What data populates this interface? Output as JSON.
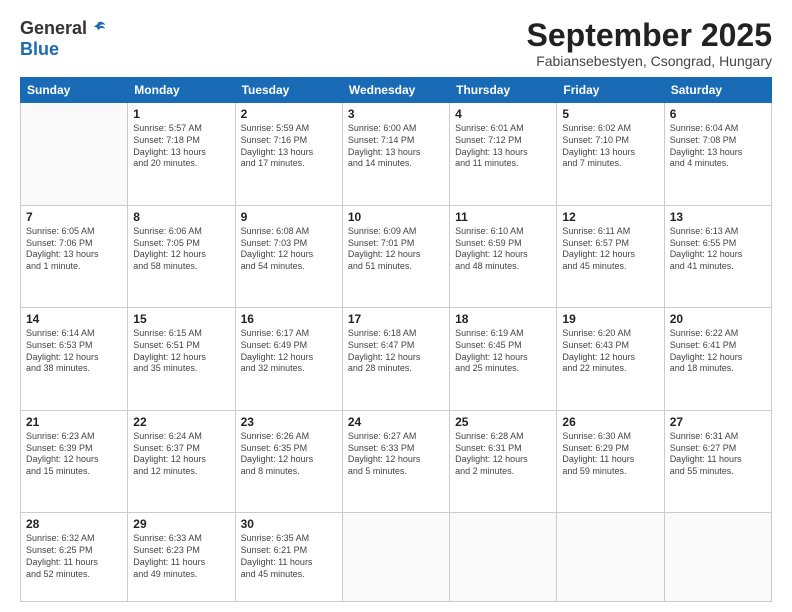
{
  "logo": {
    "general": "General",
    "blue": "Blue"
  },
  "header": {
    "month": "September 2025",
    "location": "Fabiansebestyen, Csongrad, Hungary"
  },
  "weekdays": [
    "Sunday",
    "Monday",
    "Tuesday",
    "Wednesday",
    "Thursday",
    "Friday",
    "Saturday"
  ],
  "weeks": [
    [
      {
        "day": "",
        "info": ""
      },
      {
        "day": "1",
        "info": "Sunrise: 5:57 AM\nSunset: 7:18 PM\nDaylight: 13 hours\nand 20 minutes."
      },
      {
        "day": "2",
        "info": "Sunrise: 5:59 AM\nSunset: 7:16 PM\nDaylight: 13 hours\nand 17 minutes."
      },
      {
        "day": "3",
        "info": "Sunrise: 6:00 AM\nSunset: 7:14 PM\nDaylight: 13 hours\nand 14 minutes."
      },
      {
        "day": "4",
        "info": "Sunrise: 6:01 AM\nSunset: 7:12 PM\nDaylight: 13 hours\nand 11 minutes."
      },
      {
        "day": "5",
        "info": "Sunrise: 6:02 AM\nSunset: 7:10 PM\nDaylight: 13 hours\nand 7 minutes."
      },
      {
        "day": "6",
        "info": "Sunrise: 6:04 AM\nSunset: 7:08 PM\nDaylight: 13 hours\nand 4 minutes."
      }
    ],
    [
      {
        "day": "7",
        "info": "Sunrise: 6:05 AM\nSunset: 7:06 PM\nDaylight: 13 hours\nand 1 minute."
      },
      {
        "day": "8",
        "info": "Sunrise: 6:06 AM\nSunset: 7:05 PM\nDaylight: 12 hours\nand 58 minutes."
      },
      {
        "day": "9",
        "info": "Sunrise: 6:08 AM\nSunset: 7:03 PM\nDaylight: 12 hours\nand 54 minutes."
      },
      {
        "day": "10",
        "info": "Sunrise: 6:09 AM\nSunset: 7:01 PM\nDaylight: 12 hours\nand 51 minutes."
      },
      {
        "day": "11",
        "info": "Sunrise: 6:10 AM\nSunset: 6:59 PM\nDaylight: 12 hours\nand 48 minutes."
      },
      {
        "day": "12",
        "info": "Sunrise: 6:11 AM\nSunset: 6:57 PM\nDaylight: 12 hours\nand 45 minutes."
      },
      {
        "day": "13",
        "info": "Sunrise: 6:13 AM\nSunset: 6:55 PM\nDaylight: 12 hours\nand 41 minutes."
      }
    ],
    [
      {
        "day": "14",
        "info": "Sunrise: 6:14 AM\nSunset: 6:53 PM\nDaylight: 12 hours\nand 38 minutes."
      },
      {
        "day": "15",
        "info": "Sunrise: 6:15 AM\nSunset: 6:51 PM\nDaylight: 12 hours\nand 35 minutes."
      },
      {
        "day": "16",
        "info": "Sunrise: 6:17 AM\nSunset: 6:49 PM\nDaylight: 12 hours\nand 32 minutes."
      },
      {
        "day": "17",
        "info": "Sunrise: 6:18 AM\nSunset: 6:47 PM\nDaylight: 12 hours\nand 28 minutes."
      },
      {
        "day": "18",
        "info": "Sunrise: 6:19 AM\nSunset: 6:45 PM\nDaylight: 12 hours\nand 25 minutes."
      },
      {
        "day": "19",
        "info": "Sunrise: 6:20 AM\nSunset: 6:43 PM\nDaylight: 12 hours\nand 22 minutes."
      },
      {
        "day": "20",
        "info": "Sunrise: 6:22 AM\nSunset: 6:41 PM\nDaylight: 12 hours\nand 18 minutes."
      }
    ],
    [
      {
        "day": "21",
        "info": "Sunrise: 6:23 AM\nSunset: 6:39 PM\nDaylight: 12 hours\nand 15 minutes."
      },
      {
        "day": "22",
        "info": "Sunrise: 6:24 AM\nSunset: 6:37 PM\nDaylight: 12 hours\nand 12 minutes."
      },
      {
        "day": "23",
        "info": "Sunrise: 6:26 AM\nSunset: 6:35 PM\nDaylight: 12 hours\nand 8 minutes."
      },
      {
        "day": "24",
        "info": "Sunrise: 6:27 AM\nSunset: 6:33 PM\nDaylight: 12 hours\nand 5 minutes."
      },
      {
        "day": "25",
        "info": "Sunrise: 6:28 AM\nSunset: 6:31 PM\nDaylight: 12 hours\nand 2 minutes."
      },
      {
        "day": "26",
        "info": "Sunrise: 6:30 AM\nSunset: 6:29 PM\nDaylight: 11 hours\nand 59 minutes."
      },
      {
        "day": "27",
        "info": "Sunrise: 6:31 AM\nSunset: 6:27 PM\nDaylight: 11 hours\nand 55 minutes."
      }
    ],
    [
      {
        "day": "28",
        "info": "Sunrise: 6:32 AM\nSunset: 6:25 PM\nDaylight: 11 hours\nand 52 minutes."
      },
      {
        "day": "29",
        "info": "Sunrise: 6:33 AM\nSunset: 6:23 PM\nDaylight: 11 hours\nand 49 minutes."
      },
      {
        "day": "30",
        "info": "Sunrise: 6:35 AM\nSunset: 6:21 PM\nDaylight: 11 hours\nand 45 minutes."
      },
      {
        "day": "",
        "info": ""
      },
      {
        "day": "",
        "info": ""
      },
      {
        "day": "",
        "info": ""
      },
      {
        "day": "",
        "info": ""
      }
    ]
  ]
}
